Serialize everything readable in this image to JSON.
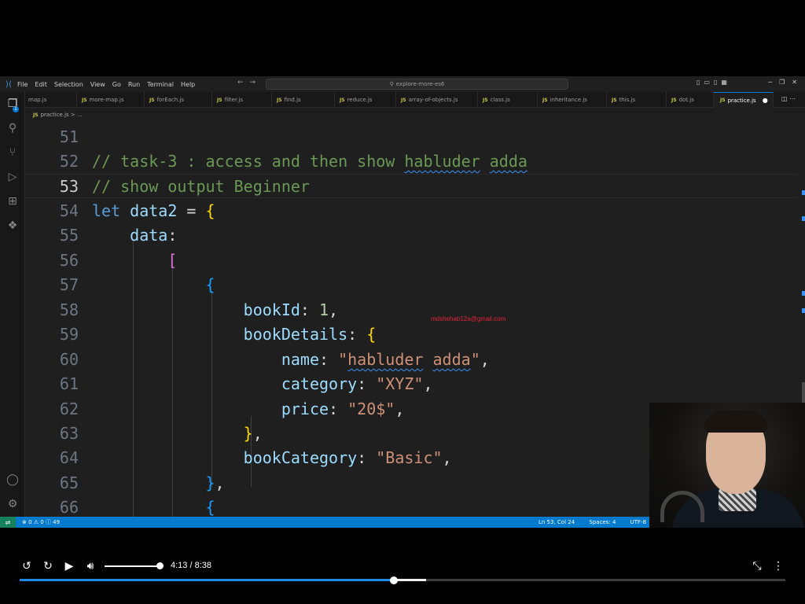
{
  "menu": [
    "File",
    "Edit",
    "Selection",
    "View",
    "Go",
    "Run",
    "Terminal",
    "Help"
  ],
  "search_text": "explore-more-es6",
  "tabs": [
    {
      "label": "map.js",
      "active": false
    },
    {
      "label": "more-map.js",
      "active": false
    },
    {
      "label": "forEach.js",
      "active": false
    },
    {
      "label": "filter.js",
      "active": false
    },
    {
      "label": "find.js",
      "active": false
    },
    {
      "label": "reduce.js",
      "active": false
    },
    {
      "label": "array-of-objects.js",
      "active": false
    },
    {
      "label": "class.js",
      "active": false
    },
    {
      "label": "inheritance.js",
      "active": false
    },
    {
      "label": "this.js",
      "active": false
    },
    {
      "label": "dot.js",
      "active": false
    },
    {
      "label": "practice.js",
      "active": true
    }
  ],
  "js_icon_text": "JS",
  "breadcrumb": {
    "file": "practice.js",
    "rest": "> ..."
  },
  "explorer_badge": "1",
  "code": {
    "line_numbers": [
      "51",
      "52",
      "53",
      "54",
      "55",
      "56",
      "57",
      "58",
      "59",
      "60",
      "61",
      "62",
      "63",
      "64",
      "65",
      "66"
    ],
    "current_line": "53",
    "l52_comment": "// task-3 : access and then show ",
    "l52_word1": "habluder",
    "l52_word2": "adda",
    "l53_comment": "// show output Beginner",
    "l54_let": "let",
    "l54_var": "data2",
    "l54_eq": " = ",
    "l55_key": "data",
    "l56_bracket": "[",
    "l57_brace": "{",
    "l58_key": "bookId",
    "l58_val": "1",
    "l59_key": "bookDetails",
    "l59_brace": "{",
    "l60_key": "name",
    "l60_q1": "\"",
    "l60_w1": "habluder",
    "l60_w2": "adda",
    "l60_q2": "\"",
    "l61_key": "category",
    "l61_val": "\"XYZ\"",
    "l62_key": "price",
    "l62_val": "\"20$\"",
    "l63_close": "}",
    "l64_key": "bookCategory",
    "l64_val": "\"Basic\"",
    "l65_close": "}",
    "l66_open": "{"
  },
  "watermark": "mdshehab12a@gmail.com",
  "status": {
    "problems": "⊗ 0 ⚠ 0 ⓘ 49",
    "position": "Ln 53, Col 24",
    "spaces": "Spaces: 4",
    "encoding": "UTF-8"
  },
  "player": {
    "time": "4:13 / 8:38",
    "progress_fraction": 0.4888,
    "buffered_fraction": 0.5308,
    "volume_fraction": 1.0
  },
  "colors": {
    "accent": "#007acc",
    "comment": "#6a9955",
    "keyword": "#569cd6",
    "string": "#ce9178",
    "progress": "#1e88e5"
  }
}
